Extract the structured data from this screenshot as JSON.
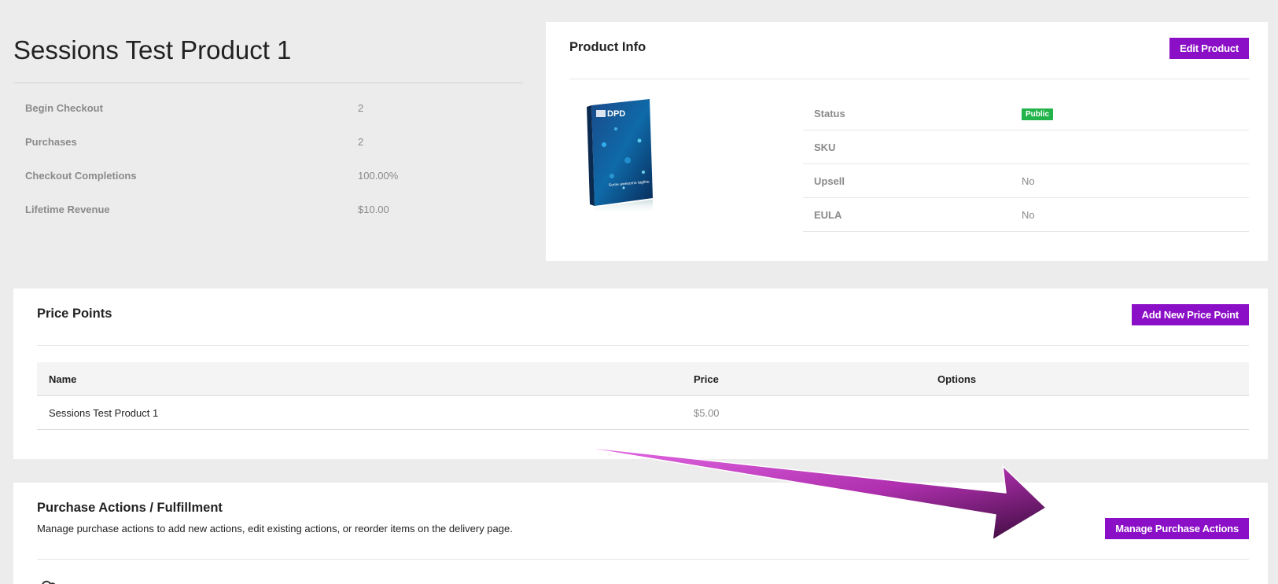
{
  "summary": {
    "title": "Sessions Test Product 1",
    "stats": [
      {
        "label": "Begin Checkout",
        "value": "2"
      },
      {
        "label": "Purchases",
        "value": "2"
      },
      {
        "label": "Checkout Completions",
        "value": "100.00%"
      },
      {
        "label": "Lifetime Revenue",
        "value": "$10.00"
      }
    ]
  },
  "product_info": {
    "title": "Product Info",
    "edit_button": "Edit Product",
    "image": {
      "brand": "DPD",
      "tagline": "Some awesome tagline",
      "icon": "product-ebook-cover"
    },
    "rows": [
      {
        "label": "Status",
        "value": "Public"
      },
      {
        "label": "SKU",
        "value": ""
      },
      {
        "label": "Upsell",
        "value": "No"
      },
      {
        "label": "EULA",
        "value": "No"
      }
    ],
    "status_color": "#22b34a"
  },
  "price_points": {
    "title": "Price Points",
    "add_button": "Add New Price Point",
    "columns": [
      "Name",
      "Price",
      "Options"
    ],
    "rows": [
      {
        "name": "Sessions Test Product 1",
        "price": "$5.00",
        "options": ""
      }
    ]
  },
  "purchase_actions": {
    "title": "Purchase Actions / Fulfillment",
    "description": "Manage purchase actions to add new actions, edit existing actions, or reorder items on the delivery page.",
    "manage_button": "Manage Purchase Actions",
    "icon": "cloud-icon"
  },
  "colors": {
    "accent": "#8b0fc6",
    "background": "#ececec",
    "arrow": "#c040c0"
  }
}
